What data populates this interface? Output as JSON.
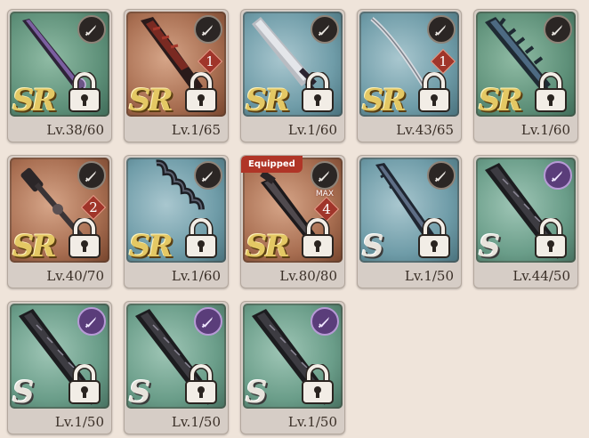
{
  "inventory": {
    "items": [
      {
        "rarity": "SR",
        "level": "Lv.38/60",
        "bg": "green",
        "badge": "sword",
        "weapon": "sword-purple"
      },
      {
        "rarity": "SR",
        "level": "Lv.1/65",
        "bg": "red",
        "badge": "sword",
        "weapon": "blade-red",
        "tier": "1"
      },
      {
        "rarity": "SR",
        "level": "Lv.1/60",
        "bg": "blue",
        "badge": "sword",
        "weapon": "greatsword"
      },
      {
        "rarity": "SR",
        "level": "Lv.43/65",
        "bg": "blue",
        "badge": "sword",
        "weapon": "katana",
        "tier": "1"
      },
      {
        "rarity": "SR",
        "level": "Lv.1/60",
        "bg": "green",
        "badge": "sword",
        "weapon": "spiked"
      },
      {
        "rarity": "SR",
        "level": "Lv.40/70",
        "bg": "red",
        "badge": "sword",
        "weapon": "mace",
        "tier": "2"
      },
      {
        "rarity": "SR",
        "level": "Lv.1/60",
        "bg": "blue",
        "badge": "sword",
        "weapon": "chain"
      },
      {
        "rarity": "SR",
        "level": "Lv.80/80",
        "bg": "red",
        "badge": "sword",
        "weapon": "dark",
        "tier": "4",
        "max": "MAX",
        "equipped": "Equipped"
      },
      {
        "rarity": "S",
        "level": "Lv.1/50",
        "bg": "blue",
        "badge": "sword",
        "weapon": "serrated"
      },
      {
        "rarity": "S",
        "level": "Lv.44/50",
        "bg": "teal",
        "badge": "s-sword",
        "weapon": "broad"
      },
      {
        "rarity": "S",
        "level": "Lv.1/50",
        "bg": "teal",
        "badge": "s-sword",
        "weapon": "broad"
      },
      {
        "rarity": "S",
        "level": "Lv.1/50",
        "bg": "teal",
        "badge": "s-sword",
        "weapon": "broad"
      },
      {
        "rarity": "S",
        "level": "Lv.1/50",
        "bg": "teal",
        "badge": "s-sword",
        "weapon": "broad"
      }
    ]
  }
}
